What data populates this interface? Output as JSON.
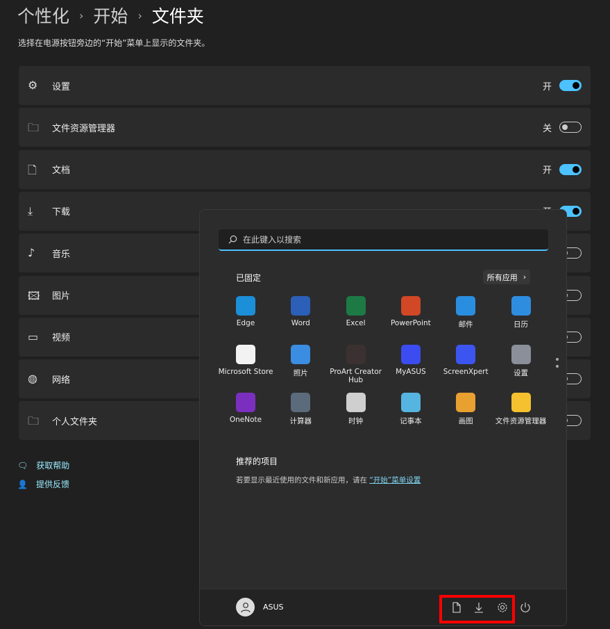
{
  "breadcrumb": [
    "个性化",
    "开始",
    "文件夹"
  ],
  "description": "选择在电源按钮旁边的“开始”菜单上显示的文件夹。",
  "folders": [
    {
      "label": "设置",
      "icon": "gear-icon",
      "state": "开",
      "on": true
    },
    {
      "label": "文件资源管理器",
      "icon": "folder-icon",
      "state": "关",
      "on": false
    },
    {
      "label": "文档",
      "icon": "document-icon",
      "state": "开",
      "on": true
    },
    {
      "label": "下载",
      "icon": "download-icon",
      "state": "开",
      "on": true
    },
    {
      "label": "音乐",
      "icon": "music-icon",
      "on": false
    },
    {
      "label": "图片",
      "icon": "picture-icon",
      "on": false
    },
    {
      "label": "视频",
      "icon": "video-icon",
      "on": false
    },
    {
      "label": "网络",
      "icon": "globe-icon",
      "on": false
    },
    {
      "label": "个人文件夹",
      "icon": "user-folder-icon",
      "on": false
    }
  ],
  "links": {
    "help": "获取帮助",
    "feedback": "提供反馈"
  },
  "start_menu": {
    "search_placeholder": "在此键入以搜索",
    "pinned_title": "已固定",
    "all_apps": "所有应用",
    "apps": [
      {
        "name": "Edge",
        "color": "#1b8fd8"
      },
      {
        "name": "Word",
        "color": "#2b5fb8"
      },
      {
        "name": "Excel",
        "color": "#1d7a45"
      },
      {
        "name": "PowerPoint",
        "color": "#d24726"
      },
      {
        "name": "邮件",
        "color": "#2a8ee0"
      },
      {
        "name": "日历",
        "color": "#2f8de0"
      },
      {
        "name": "Microsoft Store",
        "color": "#f2f2f2"
      },
      {
        "name": "照片",
        "color": "#3a8de0"
      },
      {
        "name": "ProArt Creator Hub",
        "color": "#3a3130"
      },
      {
        "name": "MyASUS",
        "color": "#3b4df0"
      },
      {
        "name": "ScreenXpert",
        "color": "#3c55f0"
      },
      {
        "name": "设置",
        "color": "#8a8f99"
      },
      {
        "name": "OneNote",
        "color": "#7b2fbf"
      },
      {
        "name": "计算器",
        "color": "#5b6b7b"
      },
      {
        "name": "时钟",
        "color": "#cfcfcf"
      },
      {
        "name": "记事本",
        "color": "#56b4e0"
      },
      {
        "name": "画图",
        "color": "#e8a030"
      },
      {
        "name": "文件资源管理器",
        "color": "#f5c12e"
      }
    ],
    "recommended_title": "推荐的项目",
    "recommended_text": "若要显示最近使用的文件和新应用，请在",
    "recommended_link": "“开始”菜单设置",
    "user": "ASUS",
    "footer_icons": [
      "document-icon",
      "download-icon",
      "gear-icon",
      "power-icon"
    ]
  },
  "colors": {
    "accent": "#4cc2ff",
    "highlight": "#ff0000"
  }
}
